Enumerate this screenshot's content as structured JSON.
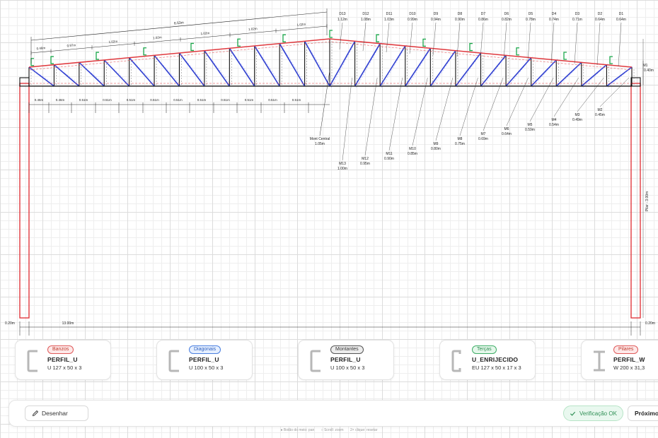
{
  "structure": {
    "span_total": "13.00m",
    "pillar_width": "0.20m",
    "pillar_height": "Pilar - 3.00m",
    "end_height_right": "0.40m",
    "end_height_label": "M1",
    "top_chord_total": "6.53m",
    "top_chord_segments": [
      "0.46m",
      "0.97m",
      "1.02m",
      "1.02m",
      "1.02m",
      "1.02m",
      "1.02m"
    ],
    "bottom_segments": [
      "0.46m",
      "0.46m",
      "0.51m",
      "0.51m",
      "0.51m",
      "0.51m",
      "0.51m",
      "0.51m",
      "0.51m",
      "0.51m",
      "0.51m",
      "0.51m"
    ],
    "central_post": {
      "name": "Mont Central",
      "value": "1.05m"
    },
    "diagonal_labels": [
      {
        "name": "D13",
        "value": "1.12m"
      },
      {
        "name": "D12",
        "value": "1.08m"
      },
      {
        "name": "D11",
        "value": "1.03m"
      },
      {
        "name": "D10",
        "value": "0.99m"
      },
      {
        "name": "D9",
        "value": "0.94m"
      },
      {
        "name": "D8",
        "value": "0.90m"
      },
      {
        "name": "D7",
        "value": "0.86m"
      },
      {
        "name": "D6",
        "value": "0.82m"
      },
      {
        "name": "D5",
        "value": "0.78m"
      },
      {
        "name": "D4",
        "value": "0.74m"
      },
      {
        "name": "D3",
        "value": "0.71m"
      },
      {
        "name": "D2",
        "value": "0.64m"
      },
      {
        "name": "D1",
        "value": "0.64m"
      }
    ],
    "vertical_labels": [
      {
        "name": "M13",
        "value": "1.00m"
      },
      {
        "name": "M12",
        "value": "0.95m"
      },
      {
        "name": "M11",
        "value": "0.90m"
      },
      {
        "name": "M10",
        "value": "0.85m"
      },
      {
        "name": "M9",
        "value": "0.80m"
      },
      {
        "name": "M8",
        "value": "0.75m"
      },
      {
        "name": "M7",
        "value": "0.69m"
      },
      {
        "name": "M6",
        "value": "0.64m"
      },
      {
        "name": "M5",
        "value": "0.59m"
      },
      {
        "name": "M4",
        "value": "0.54m"
      },
      {
        "name": "M3",
        "value": "0.49m"
      },
      {
        "name": "M2",
        "value": "0.45m"
      }
    ]
  },
  "colors": {
    "top_chord": "#e0393e",
    "diagonals": "#2f3fd0",
    "verticals": "#111111",
    "pillars": "#e0393e",
    "purlins": "#1aa84a",
    "dim_line": "#222222"
  },
  "profiles": [
    {
      "badge": "Banzos",
      "type": "PERFIL_U",
      "dims": "U 127 x 50 x 3",
      "badge_bg": "#fde8e8",
      "badge_border": "#e05a5a",
      "badge_fg": "#c0392b",
      "shape": "u-shape"
    },
    {
      "badge": "Diagonais",
      "type": "PERFIL_U",
      "dims": "U 100 x 50 x 3",
      "badge_bg": "#e5efff",
      "badge_border": "#4a7fe0",
      "badge_fg": "#2d5fbf",
      "shape": "u-shape"
    },
    {
      "badge": "Montantes",
      "type": "PERFIL_U",
      "dims": "U 100 x 50 x 3",
      "badge_bg": "#ececec",
      "badge_border": "#555555",
      "badge_fg": "#333333",
      "shape": "u-shape"
    },
    {
      "badge": "Terças",
      "type": "U_ENRIJECIDO",
      "dims": "EU 127 x 50 x 17 x 3",
      "badge_bg": "#e4f7ea",
      "badge_border": "#3fae67",
      "badge_fg": "#2a8a4e",
      "shape": "u-stiffened-shape"
    },
    {
      "badge": "Pilares",
      "type": "PERFIL_W",
      "dims": "W 200 x 31,3",
      "badge_bg": "#fde8e8",
      "badge_border": "#e05a5a",
      "badge_fg": "#c0392b",
      "shape": "i-shape"
    }
  ],
  "toolbar": {
    "draw_label": "Desenhar",
    "status_label": "Verificação OK",
    "next_label": "Próximo"
  },
  "hints": [
    "● Botão do meio: pan",
    "○ Scroll: zoom",
    "2× clique: resetar"
  ]
}
